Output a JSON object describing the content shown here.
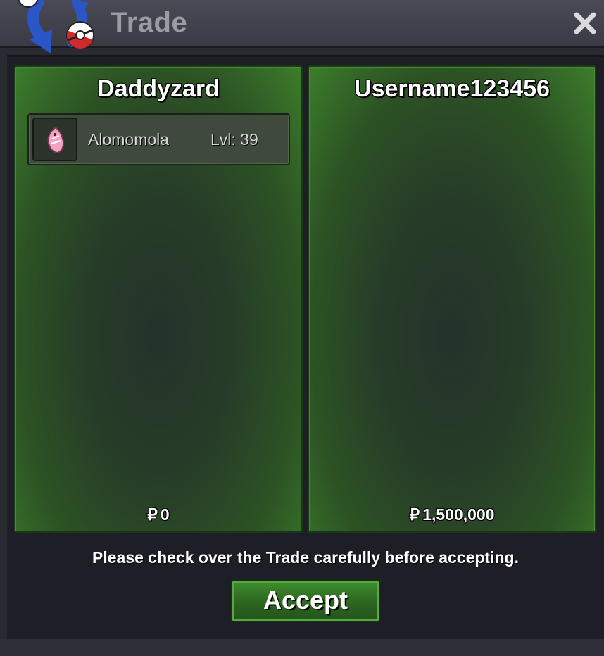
{
  "window": {
    "title": "Trade",
    "close_icon": "close-icon",
    "logo_icon": "trade-swap-logo-icon"
  },
  "trade": {
    "left": {
      "player_name": "Daddyzard",
      "items": [
        {
          "icon": "alomomola-sprite-icon",
          "name": "Alomomola",
          "level": "Lvl: 39"
        }
      ],
      "currency_symbol": "₽",
      "money": "0"
    },
    "right": {
      "player_name": "Username123456",
      "items": [],
      "currency_symbol": "₽",
      "money": "1,500,000"
    }
  },
  "footer": {
    "notice": "Please check over the Trade carefully before accepting.",
    "accept_label": "Accept"
  },
  "colors": {
    "panel_green": "#3c7d2b",
    "button_green": "#2c6520",
    "window_bg": "#1e1e27"
  }
}
